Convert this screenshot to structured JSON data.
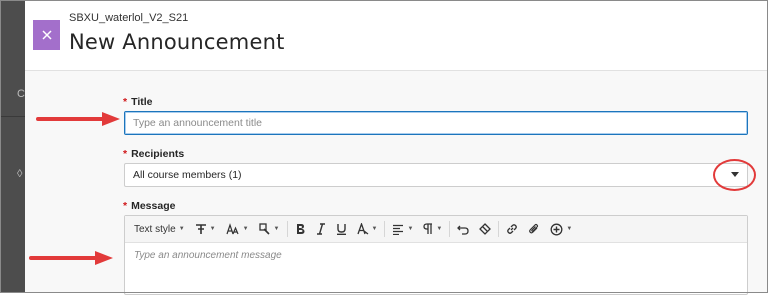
{
  "panel": {
    "course_name": "SBXU_waterlol_V2_S21",
    "title": "New Announcement"
  },
  "form": {
    "required_mark": "*",
    "title_label": "Title",
    "title_placeholder": "Type an announcement title",
    "recipients_label": "Recipients",
    "recipients_value": "All course members (1)",
    "message_label": "Message",
    "message_placeholder": "Type an announcement message"
  },
  "toolbar": {
    "text_style_label": "Text style",
    "items": [
      "paragraph-format-icon",
      "font-size-icon",
      "text-color-icon",
      "bold-icon",
      "italic-icon",
      "underline-icon",
      "more-formatting-icon",
      "align-icon",
      "paragraph-icon",
      "undo-icon",
      "clear-format-icon",
      "link-icon",
      "attach-icon",
      "insert-content-icon"
    ]
  },
  "colors": {
    "close_button": "#a36fcb",
    "focus_border": "#1c75bc",
    "required": "#d0181b",
    "annotation_red": "#e23a3a"
  }
}
